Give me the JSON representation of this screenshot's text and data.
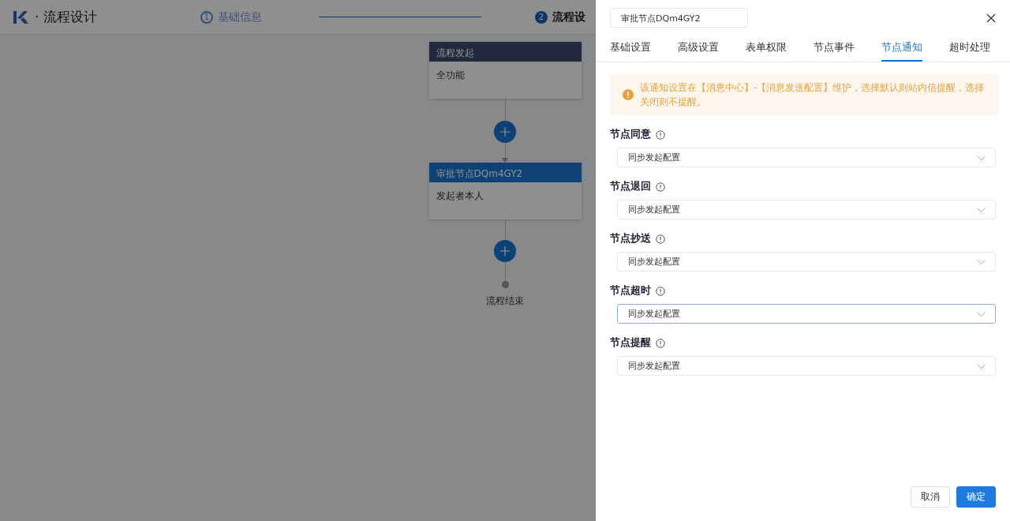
{
  "header": {
    "title": "· 流程设计",
    "steps": [
      {
        "number": "1",
        "label": "基础信息",
        "selected": false
      },
      {
        "number": "2",
        "label": "流程设",
        "selected": true
      }
    ]
  },
  "flow": {
    "nodes": [
      {
        "kind": "start",
        "title": "流程发起",
        "body": "全功能"
      },
      {
        "kind": "approver",
        "title": "审批节点DQm4GY2",
        "body": "发起者本人"
      }
    ],
    "end_label": "流程结束"
  },
  "drawer": {
    "title_value": "审批节点DQm4GY2",
    "tabs": [
      {
        "label": "基础设置",
        "selected": false
      },
      {
        "label": "高级设置",
        "selected": false
      },
      {
        "label": "表单权限",
        "selected": false
      },
      {
        "label": "节点事件",
        "selected": false
      },
      {
        "label": "节点通知",
        "selected": true
      },
      {
        "label": "超时处理",
        "selected": false
      }
    ],
    "alert": "该通知设置在【消息中心】-【消息发送配置】维护，选择默认则站内信提醒，选择关闭则不提醒。",
    "fields": [
      {
        "label": "节点同意",
        "value": "同步发起配置",
        "focused": false
      },
      {
        "label": "节点退回",
        "value": "同步发起配置",
        "focused": false
      },
      {
        "label": "节点抄送",
        "value": "同步发起配置",
        "focused": false
      },
      {
        "label": "节点超时",
        "value": "同步发起配置",
        "focused": true
      },
      {
        "label": "节点提醒",
        "value": "同步发起配置",
        "focused": false
      }
    ],
    "buttons": [
      {
        "label": "取消",
        "kind": "default"
      },
      {
        "label": "确定",
        "kind": "primary"
      }
    ]
  }
}
